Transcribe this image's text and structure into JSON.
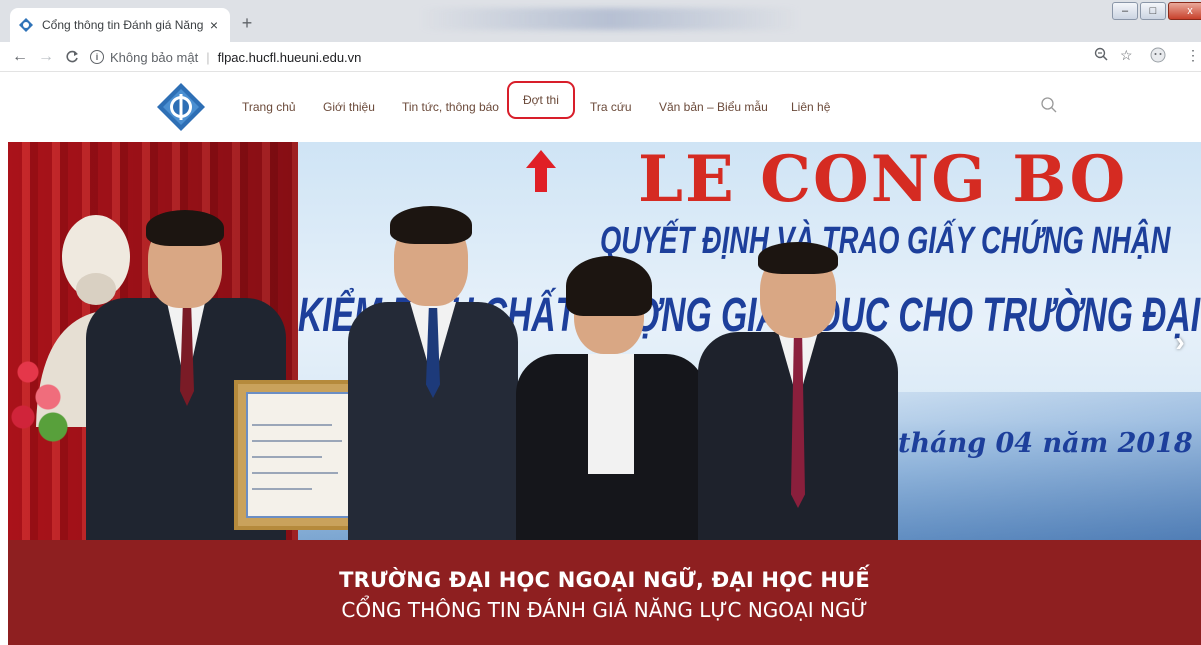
{
  "browser": {
    "tab_title": "Cổng thông tin Đánh giá Năng lự",
    "tab_close": "×",
    "new_tab": "+",
    "security_label": "Không bảo mật",
    "url": "flpac.hucfl.hueuni.edu.vn",
    "window_controls": {
      "minimize": "–",
      "maximize": "□",
      "close": "x"
    }
  },
  "nav": {
    "items": [
      {
        "label": "Trang chủ"
      },
      {
        "label": "Giới thiệu"
      },
      {
        "label": "Tin tức, thông báo"
      },
      {
        "label": "Đợt thi"
      },
      {
        "label": "Tra cứu"
      },
      {
        "label": "Văn bản – Biểu mẫu"
      },
      {
        "label": "Liên hệ"
      }
    ],
    "highlighted_item": "Đợt thi"
  },
  "hero": {
    "title": "LE CONG BO",
    "line2": "QUYẾT ĐỊNH VÀ TRAO GIẤY CHỨNG NHẬN",
    "line3": "KIỂM ĐỊNH CHẤT LƯỢNG GIÁO DỤC CHO TRƯỜNG ĐẠI HỌC NGOẠI NGỮ",
    "date": "tháng 04 năm 2018",
    "next_arrow": "›"
  },
  "footer": {
    "line1": "TRƯỜNG ĐẠI HỌC NGOẠI NGỮ, ĐẠI HỌC HUẾ",
    "line2": "CỔNG THÔNG TIN ĐÁNH GIÁ NĂNG LỰC NGOẠI NGỮ"
  },
  "colors": {
    "accent_red": "#d81e2a",
    "footer_band": "#8e1f20",
    "menu_text": "#6b4a3a",
    "banner_blue": "#1d3f9b"
  },
  "icons": [
    "site-logo-icon",
    "search-icon",
    "back-icon",
    "forward-icon",
    "reload-icon",
    "info-icon",
    "zoom-icon",
    "star-icon",
    "profile-icon",
    "menu-dots-icon",
    "annotation-arrow-icon"
  ]
}
